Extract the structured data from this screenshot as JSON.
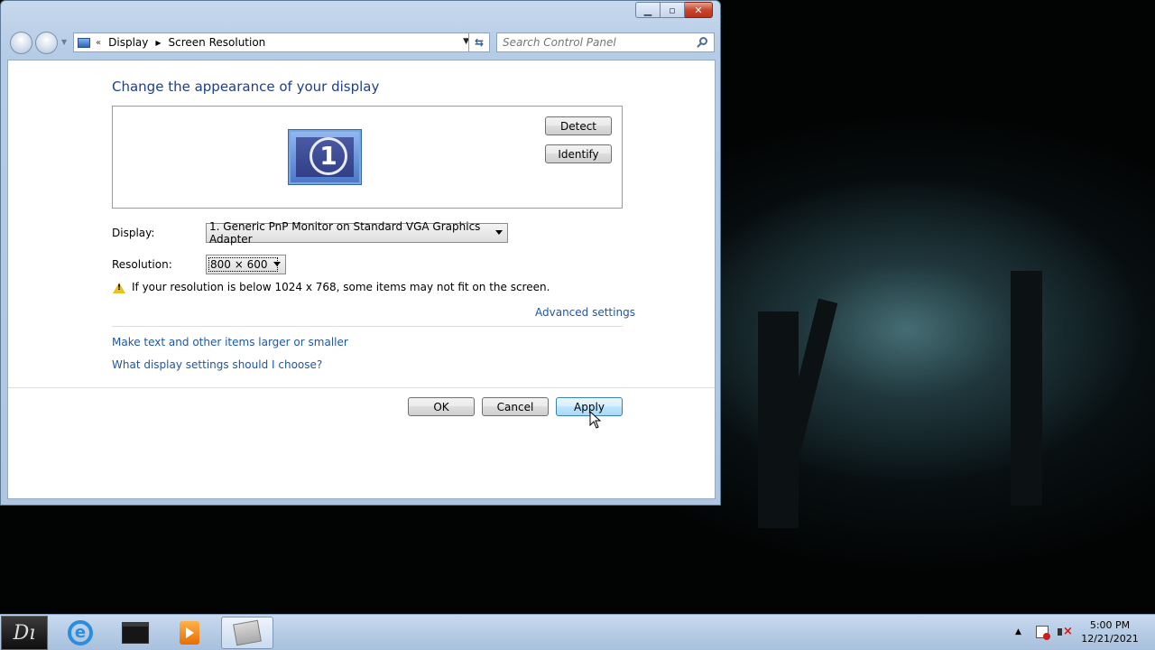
{
  "window": {
    "caption_buttons": {
      "minimize_icon": "minimize-icon",
      "maximize_icon": "maximize-icon",
      "close_icon": "close-icon"
    },
    "nav": {
      "breadcrumb": [
        "Display",
        "Screen Resolution"
      ],
      "breadcrumb_overflow": "«",
      "search_placeholder": "Search Control Panel"
    }
  },
  "main": {
    "heading": "Change the appearance of your display",
    "detect_label": "Detect",
    "identify_label": "Identify",
    "monitor_number": "1",
    "display_label": "Display:",
    "display_value": "1. Generic PnP Monitor on Standard VGA Graphics Adapter",
    "resolution_label": "Resolution:",
    "resolution_value": "800 × 600",
    "warning_text": "If your resolution is below 1024 x 768, some items may not fit on the screen.",
    "advanced_link": "Advanced settings",
    "link_text_size": "Make text and other items larger or smaller",
    "link_display_help": "What display settings should I choose?",
    "ok_label": "OK",
    "cancel_label": "Cancel",
    "apply_label": "Apply"
  },
  "taskbar": {
    "start_label": "Dı",
    "ie_glyph": "e",
    "items": [
      "start-orb",
      "internet-explorer-icon",
      "folder-icon",
      "media-player-icon",
      "control-panel-icon"
    ],
    "clock_time": "5:00 PM",
    "clock_date": "12/21/2021",
    "tray_arrow": "▲"
  },
  "colors": {
    "heading": "#1e3f8a",
    "link": "#1f56a8",
    "warning": "#e8c022"
  }
}
